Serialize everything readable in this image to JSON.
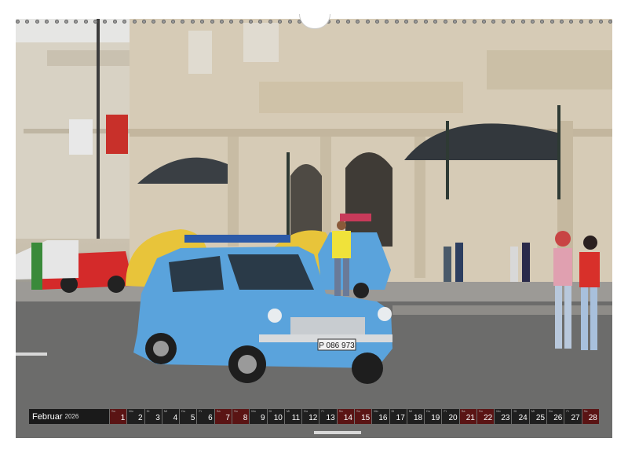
{
  "calendar": {
    "month": "Februar",
    "year": "2026",
    "days": [
      {
        "dow": "So",
        "num": "1",
        "weekend": true
      },
      {
        "dow": "Mo",
        "num": "2",
        "weekend": false
      },
      {
        "dow": "Di",
        "num": "3",
        "weekend": false
      },
      {
        "dow": "Mi",
        "num": "4",
        "weekend": false
      },
      {
        "dow": "Do",
        "num": "5",
        "weekend": false
      },
      {
        "dow": "Fr",
        "num": "6",
        "weekend": false
      },
      {
        "dow": "Sa",
        "num": "7",
        "weekend": true
      },
      {
        "dow": "So",
        "num": "8",
        "weekend": true
      },
      {
        "dow": "Mo",
        "num": "9",
        "weekend": false
      },
      {
        "dow": "Di",
        "num": "10",
        "weekend": false
      },
      {
        "dow": "Mi",
        "num": "11",
        "weekend": false
      },
      {
        "dow": "Do",
        "num": "12",
        "weekend": false
      },
      {
        "dow": "Fr",
        "num": "13",
        "weekend": false
      },
      {
        "dow": "Sa",
        "num": "14",
        "weekend": true
      },
      {
        "dow": "So",
        "num": "15",
        "weekend": true
      },
      {
        "dow": "Mo",
        "num": "16",
        "weekend": false
      },
      {
        "dow": "Di",
        "num": "17",
        "weekend": false
      },
      {
        "dow": "Mi",
        "num": "18",
        "weekend": false
      },
      {
        "dow": "Do",
        "num": "19",
        "weekend": false
      },
      {
        "dow": "Fr",
        "num": "20",
        "weekend": false
      },
      {
        "dow": "Sa",
        "num": "21",
        "weekend": true
      },
      {
        "dow": "So",
        "num": "22",
        "weekend": true
      },
      {
        "dow": "Mo",
        "num": "23",
        "weekend": false
      },
      {
        "dow": "Di",
        "num": "24",
        "weekend": false
      },
      {
        "dow": "Mi",
        "num": "25",
        "weekend": false
      },
      {
        "dow": "Do",
        "num": "26",
        "weekend": false
      },
      {
        "dow": "Fr",
        "num": "27",
        "weekend": false
      },
      {
        "dow": "Sa",
        "num": "28",
        "weekend": true
      }
    ]
  },
  "photo": {
    "license_plate": "P 086 973",
    "colors": {
      "car_blue": "#5aa3dc",
      "taxi_yellow": "#e8c43a",
      "red_car": "#d42a2a",
      "flag_red": "#c8302a"
    }
  }
}
